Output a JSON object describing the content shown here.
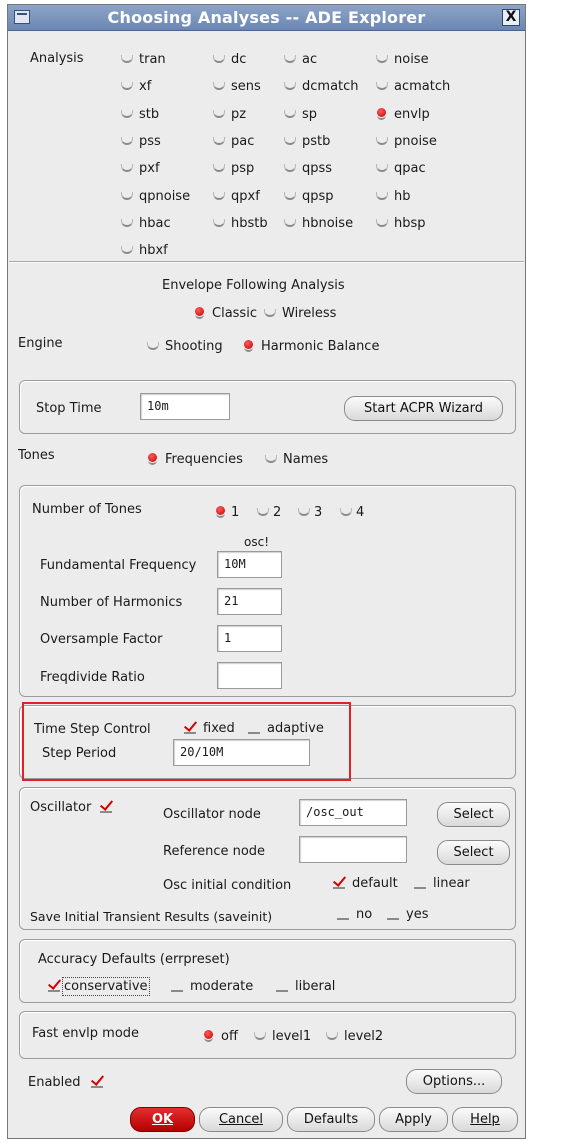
{
  "window": {
    "title": "Choosing Analyses -- ADE Explorer",
    "close_glyph": "X"
  },
  "analysis": {
    "label": "Analysis",
    "selected": "envlp",
    "options": [
      "tran",
      "dc",
      "ac",
      "noise",
      "xf",
      "sens",
      "dcmatch",
      "acmatch",
      "stb",
      "pz",
      "sp",
      "envlp",
      "pss",
      "pac",
      "pstb",
      "pnoise",
      "pxf",
      "psp",
      "qpss",
      "qpac",
      "qpnoise",
      "qpxf",
      "qpsp",
      "hb",
      "hbac",
      "hbstb",
      "hbnoise",
      "hbsp",
      "hbxf"
    ]
  },
  "envelope": {
    "heading": "Envelope Following Analysis",
    "mode_options": [
      "Classic",
      "Wireless"
    ],
    "mode_selected": "Classic",
    "engine_label": "Engine",
    "engine_options": [
      "Shooting",
      "Harmonic Balance"
    ],
    "engine_selected": "Harmonic Balance"
  },
  "stop_time": {
    "label": "Stop Time",
    "value": "10m",
    "wizard_button": "Start ACPR Wizard"
  },
  "tones": {
    "label": "Tones",
    "options": [
      "Frequencies",
      "Names"
    ],
    "selected": "Frequencies",
    "number_label": "Number of Tones",
    "number_options": [
      "1",
      "2",
      "3",
      "4"
    ],
    "number_selected": "1",
    "column_header": "osc!",
    "fundamental_label": "Fundamental Frequency",
    "fundamental_value": "10M",
    "harmonics_label": "Number of Harmonics",
    "harmonics_value": "21",
    "oversample_label": "Oversample Factor",
    "oversample_value": "1",
    "freqdivide_label": "Freqdivide Ratio",
    "freqdivide_value": ""
  },
  "time_step": {
    "label": "Time Step Control",
    "fixed_label": "fixed",
    "fixed_checked": true,
    "adaptive_label": "adaptive",
    "adaptive_checked": false,
    "period_label": "Step Period",
    "period_value": "20/10M"
  },
  "oscillator": {
    "label": "Oscillator",
    "checked": true,
    "node_label": "Oscillator node",
    "node_value": "/osc_out",
    "select_label": "Select",
    "ref_label": "Reference node",
    "ref_value": "",
    "ic_label": "Osc initial condition",
    "ic_default": "default",
    "ic_default_checked": true,
    "ic_linear": "linear",
    "ic_linear_checked": false,
    "saveinit_label": "Save Initial Transient Results (saveinit)",
    "saveinit_no": "no",
    "saveinit_yes": "yes"
  },
  "accuracy": {
    "label": "Accuracy Defaults (errpreset)",
    "options": [
      "conservative",
      "moderate",
      "liberal"
    ],
    "checked": "conservative"
  },
  "fast_envlp": {
    "label": "Fast envlp mode",
    "options": [
      "off",
      "level1",
      "level2"
    ],
    "selected": "off"
  },
  "footer": {
    "enabled_label": "Enabled",
    "enabled_checked": true,
    "options_button": "Options...",
    "buttons": {
      "ok": "OK",
      "cancel": "Cancel",
      "defaults": "Defaults",
      "apply": "Apply",
      "help": "Help"
    }
  },
  "colors": {
    "accent_red": "#d40000",
    "title_bar": "#7a93bb",
    "highlight_box": "#e0202a"
  }
}
